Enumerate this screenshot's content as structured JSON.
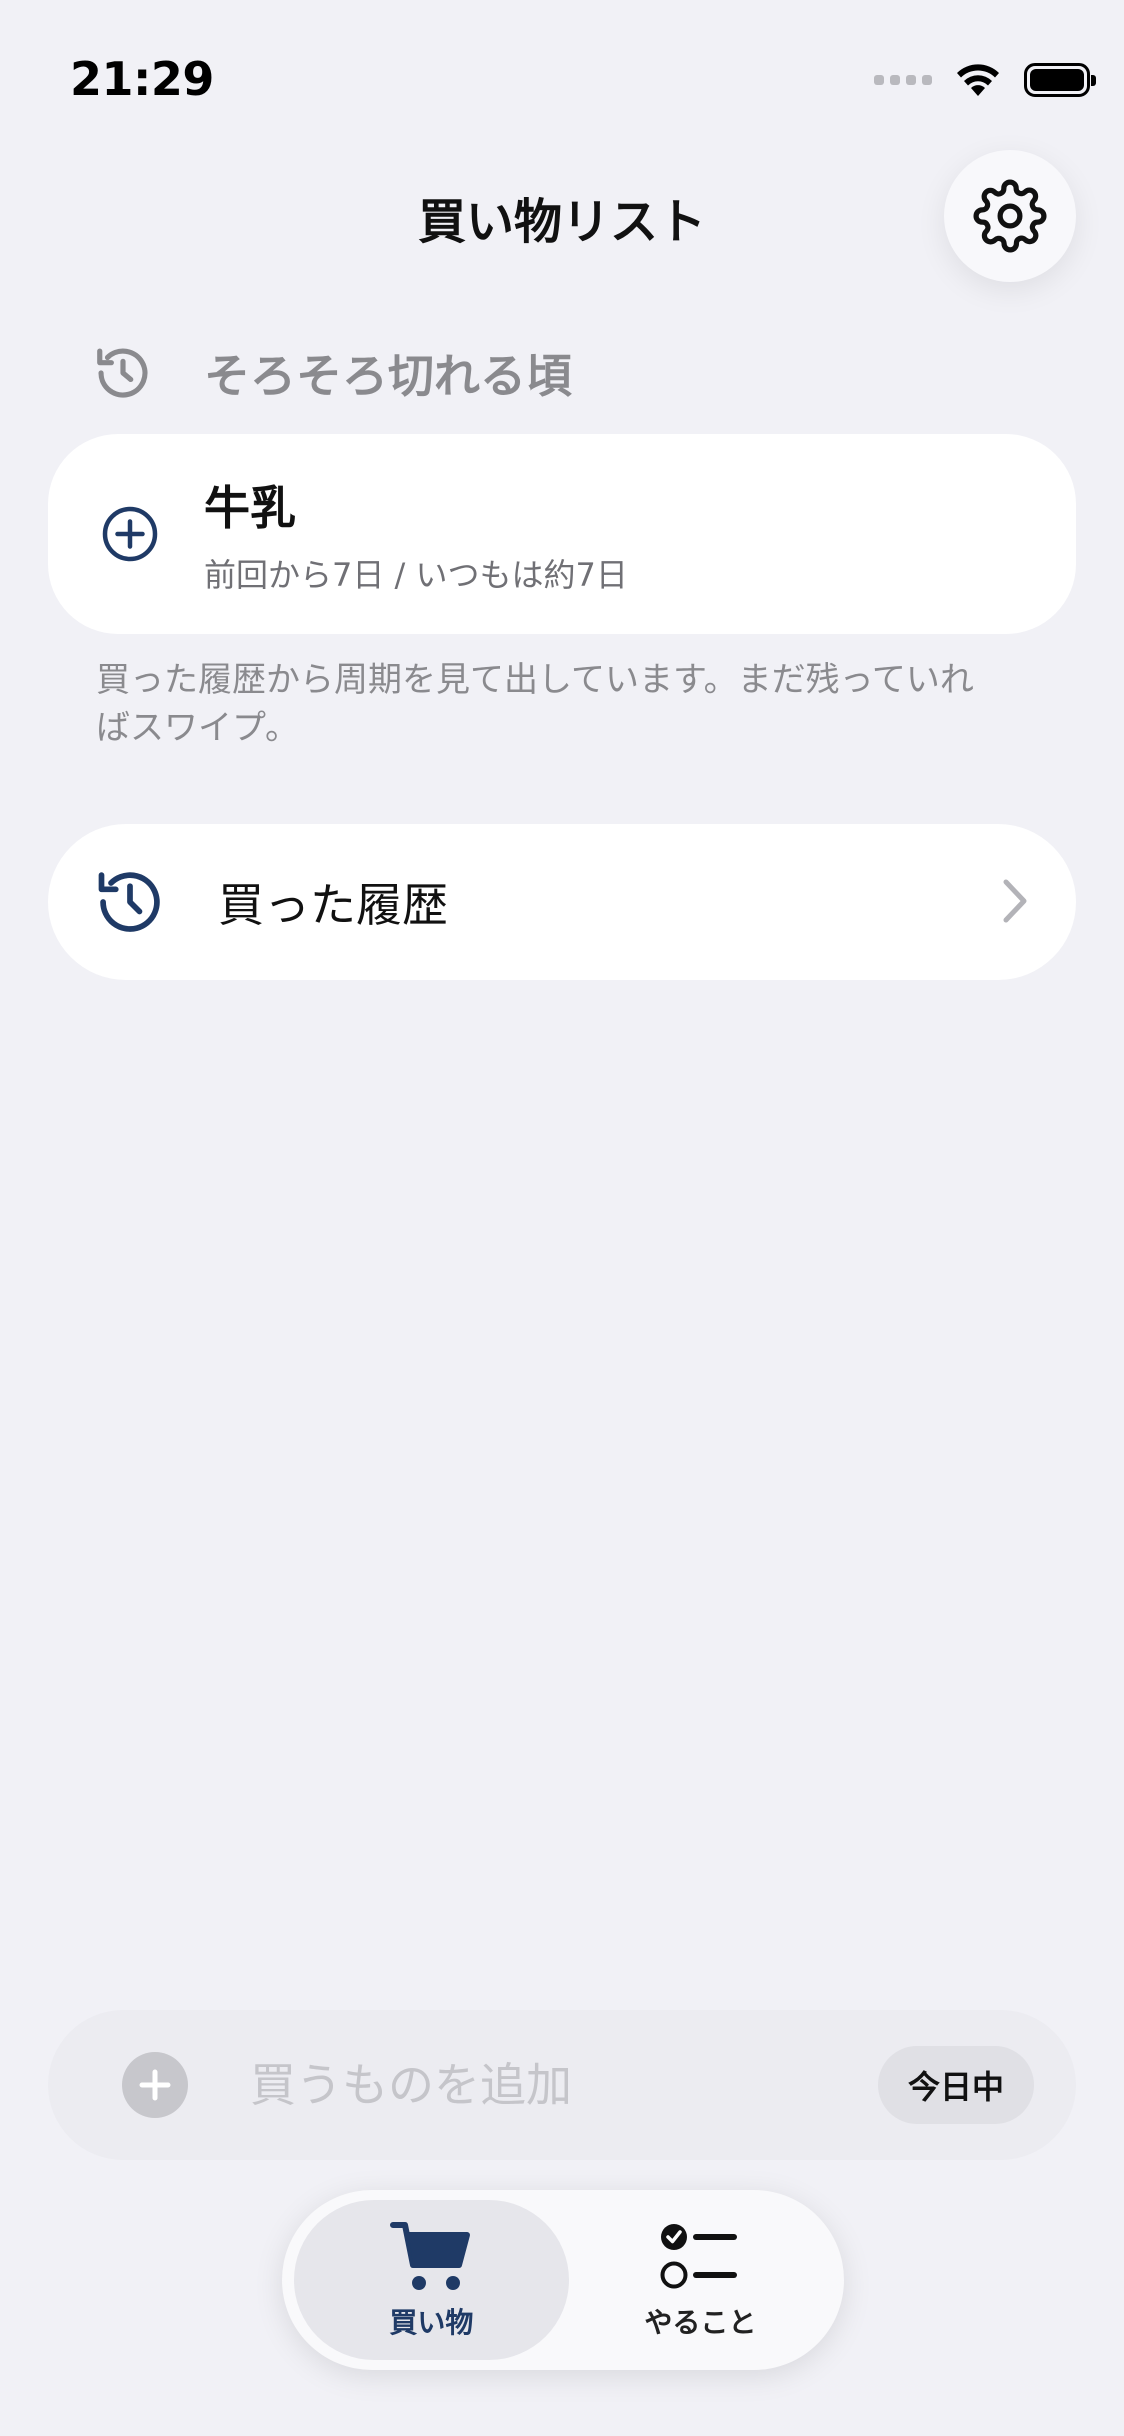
{
  "status_bar": {
    "time": "21:29"
  },
  "header": {
    "title": "買い物リスト"
  },
  "section": {
    "title": "そろそろ切れる頃"
  },
  "due_item": {
    "name": "牛乳",
    "detail": "前回から7日 / いつもは約7日"
  },
  "hint": "買った履歴から周期を見て出しています。まだ残っていればスワイプ。",
  "history": {
    "label": "買った履歴"
  },
  "add_bar": {
    "placeholder": "買うものを追加",
    "due_label": "今日中"
  },
  "tabs": [
    {
      "label": "買い物",
      "active": true
    },
    {
      "label": "やること",
      "active": false
    }
  ],
  "colors": {
    "accent": "#1f3a66",
    "background": "#f1f1f6",
    "muted": "#8a8a8e"
  }
}
